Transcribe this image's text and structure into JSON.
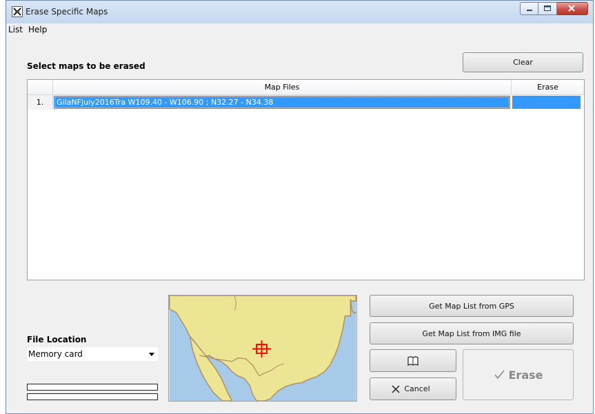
{
  "window": {
    "title": "Erase Specific Maps"
  },
  "menu": {
    "items": [
      "List",
      "Help"
    ]
  },
  "maps_section": {
    "label": "Select maps to be erased",
    "clear_label": "Clear"
  },
  "table": {
    "columns": [
      "Map Files",
      "Erase"
    ],
    "rows": [
      {
        "number": "1.",
        "file": "GilaNFJuly2016Tra  W109.40 - W106.90  ;  N32.27 - N34.38",
        "erase": ""
      }
    ]
  },
  "file_location": {
    "label": "File Location",
    "selected": "Memory card"
  },
  "progress": {
    "bar1": 0,
    "bar2": 0
  },
  "buttons": {
    "get_gps": "Get Map List from GPS",
    "get_img": "Get Map List from IMG file",
    "help_icon": "book-icon",
    "cancel_icon": "x-icon",
    "cancel": "Cancel",
    "erase_icon": "check-icon",
    "erase": "Erase"
  },
  "colors": {
    "selection": "#3399ff",
    "water": "#a6cae8",
    "land": "#ece694",
    "border": "#b08f62",
    "marker": "#ff0000"
  }
}
